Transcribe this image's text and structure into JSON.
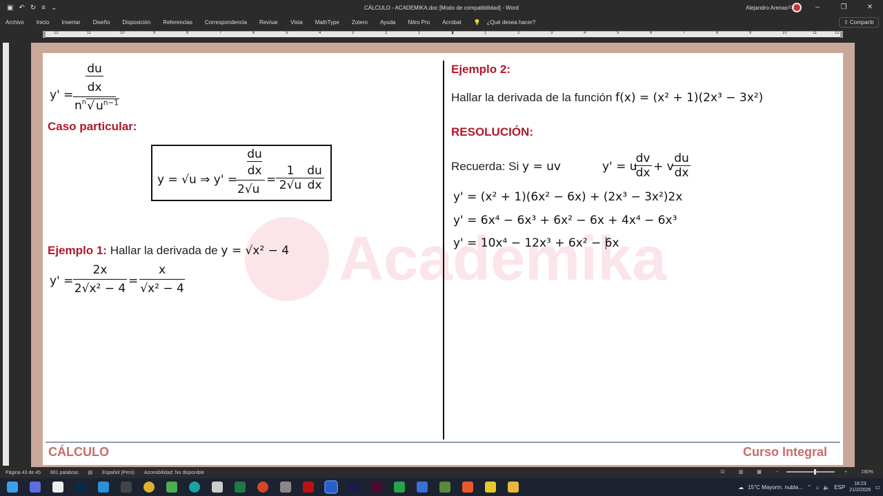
{
  "titlebar": {
    "doc_title": "CÁLCULO - ACADEMIKA.doc [Modo de compatibilidad] - Word",
    "user_name": "Alejandro Arenas",
    "save_icon": "save-icon",
    "undo_icon": "undo-icon",
    "redo_icon": "redo-icon"
  },
  "menu": {
    "items": [
      "Archivo",
      "Inicio",
      "Insertar",
      "Diseño",
      "Disposición",
      "Referencias",
      "Correspondencia",
      "Revisar",
      "Vista",
      "MathType",
      "Zotero",
      "Ayuda",
      "Nitro Pro",
      "Acrobat"
    ],
    "search": "¿Qué desea hacer?",
    "share": "Compartir"
  },
  "ruler": {
    "marks": [
      "12",
      "11",
      "10",
      "9",
      "8",
      "7",
      "6",
      "5",
      "4",
      "3",
      "2",
      "1",
      "1",
      "2",
      "3",
      "4",
      "5",
      "6",
      "7",
      "8",
      "9",
      "10",
      "11",
      "12"
    ]
  },
  "left_col": {
    "formula_top_num": "du",
    "formula_top_mid": "dx",
    "formula_top_lhs": "y' =",
    "formula_top_den": "n√u",
    "formula_top_den_exp": "n−1",
    "formula_top_den_root": "n",
    "caso_particular": "Caso particular:",
    "box": {
      "lhs": "y = √u ⇒ y' =",
      "frac1_num": "du",
      "frac1_mid": "dx",
      "frac1_den": "2√u",
      "eq": "=",
      "frac2_num": "1",
      "frac2_den": "2√u",
      "frac3_num": "du",
      "frac3_den": "dx"
    },
    "ejemplo1_label": "Ejemplo 1:",
    "ejemplo1_text": "Hallar la derivada de",
    "ejemplo1_fn": "y = √x² − 4",
    "ej1_lhs": "y' =",
    "ej1_num1": "2x",
    "ej1_den1": "2√x² − 4",
    "ej1_eq": "=",
    "ej1_num2": "x",
    "ej1_den2": "√x² − 4"
  },
  "right_col": {
    "ejemplo2_label": "Ejemplo 2:",
    "ejemplo2_text": "Hallar la derivada de la función",
    "ejemplo2_fn": "f(x) = (x² + 1)(2x³ − 3x²)",
    "resolucion": "RESOLUCIÓN:",
    "recuerda": "Recuerda: Si",
    "recuerda_fn": "y = uv",
    "rule_lhs": "y' = u",
    "rule_f1_num": "dv",
    "rule_f1_den": "dx",
    "rule_mid": "+ v",
    "rule_f2_num": "du",
    "rule_f2_den": "dx",
    "step1": "y' = (x² + 1)(6x² − 6x) + (2x³ − 3x²)2x",
    "step2": "y' = 6x⁴ − 6x³ + 6x² − 6x + 4x⁴ − 6x³",
    "step3": "y' = 10x⁴ − 12x³ + 6x² − 6x"
  },
  "watermark": {
    "text": "Academika"
  },
  "footer": {
    "left": "CÁLCULO",
    "right": "Curso Integral"
  },
  "status": {
    "page": "Página 43 de 45",
    "words": "861 palabras",
    "lang": "Español (Perú)",
    "access": "Accesibilidad: No disponible",
    "zoom": "190%"
  },
  "taskbar": {
    "weather": "15°C  Mayorm. nubla...",
    "lang": "ESP",
    "time": "18:23",
    "date": "21/2/2026"
  },
  "colors": {
    "accent_red": "#b0182a",
    "footer_red": "#c96b6b",
    "watermark": "#e6334a"
  }
}
